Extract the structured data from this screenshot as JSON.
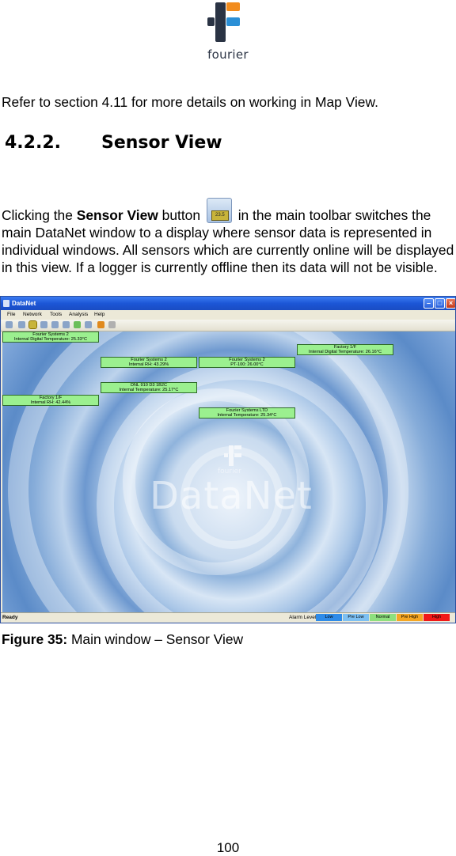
{
  "logo": {
    "word": "fourier",
    "colors": {
      "dark": "#2a3344",
      "orange": "#f28c1e",
      "blue": "#2b8fd6"
    }
  },
  "intro": "Refer to section 4.11 for more details on working in Map View.",
  "heading": {
    "number": "4.2.2.",
    "title": "Sensor View"
  },
  "paragraph": {
    "before": "Clicking the ",
    "bold": "Sensor View",
    "after_bold": " button ",
    "icon_text": "23.5",
    "after": " in the main toolbar switches the main DataNet window to a display where sensor data is represented in individual windows. All sensors which are currently online will be displayed in this view. If a logger is currently offline then its data will not be visible."
  },
  "window": {
    "title": "DataNet",
    "menu": [
      "File",
      "Network",
      "Tools",
      "Analysis",
      "Help"
    ],
    "sensors": [
      {
        "line1": "Fourier Systems 2",
        "line2": "Internal Digital Temperature: 25.33°C"
      },
      {
        "line1": "Factory 1/F",
        "line2": "Internal Digital Temperature: 26.16°C"
      },
      {
        "line1": "Fourier Systems 2",
        "line2": "Internal RH: 43.29%"
      },
      {
        "line1": "Fourier Systems 2",
        "line2": "PT-100: 26.00°C"
      },
      {
        "line1": "DNL 910 D3 1B2C",
        "line2": "Internal Temperature: 25.17°C"
      },
      {
        "line1": "Factory 1/F",
        "line2": "Internal RH: 42.44%"
      },
      {
        "line1": "Fourier Systems LTD",
        "line2": "Internal Temperature: 25.34°C"
      }
    ],
    "watermark": {
      "word": "fourier",
      "text": "DataNet"
    },
    "status": {
      "ready": "Ready",
      "alarm_label": "Alarm Level:",
      "levels": [
        {
          "label": "Low",
          "color": "#2e8be8"
        },
        {
          "label": "Pre Low",
          "color": "#7dc0f2"
        },
        {
          "label": "Normal",
          "color": "#8ee07e"
        },
        {
          "label": "Pre High",
          "color": "#f5a623"
        },
        {
          "label": "High",
          "color": "#f01818"
        }
      ]
    }
  },
  "caption": {
    "bold": "Figure 35:",
    "text": " Main window – Sensor View"
  },
  "page_number": "100"
}
